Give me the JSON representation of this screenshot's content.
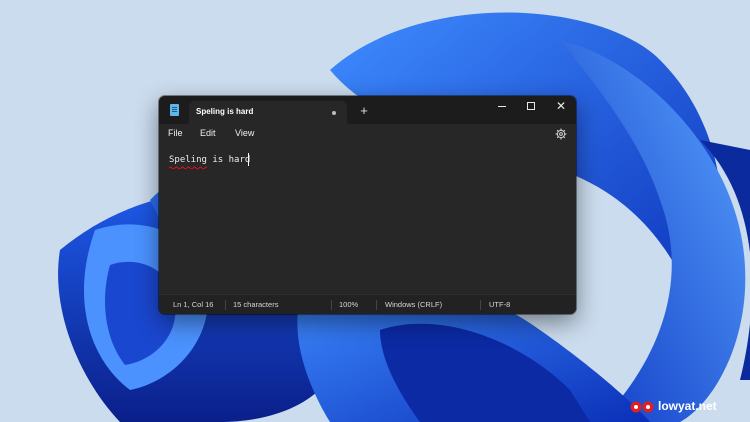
{
  "tab": {
    "title": "Speling is hard",
    "new_tab_glyph": "+"
  },
  "window_controls": {
    "close_glyph": "✕"
  },
  "menu": {
    "file": "File",
    "edit": "Edit",
    "view": "View"
  },
  "editor": {
    "content": "Speling is hard",
    "misspelled_word": "Speling"
  },
  "status": {
    "position": "Ln 1, Col 16",
    "characters": "15 characters",
    "zoom": "100%",
    "line_endings": "Windows (CRLF)",
    "encoding": "UTF-8"
  },
  "watermark": {
    "text": "lowyat.net"
  },
  "icons": [
    "notepad-icon",
    "new-tab-icon",
    "minimize-icon",
    "maximize-icon",
    "close-icon",
    "settings-gear-icon",
    "watermark-logo-icon"
  ],
  "colors": {
    "wallpaper_bg": "#c9d9ec",
    "wallpaper_blue": "#1447d6",
    "window_bg": "#272727",
    "titlebar_bg": "#1c1c1c",
    "spellcheck_underline": "#e81123",
    "watermark_red": "#e02020"
  }
}
